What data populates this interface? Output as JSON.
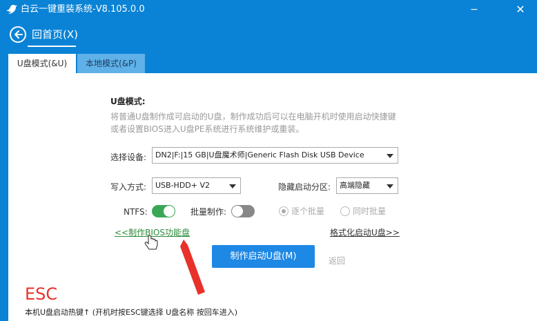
{
  "window": {
    "title": "白云一键重装系统-V8.105.0.0",
    "minimize_glyph": "−",
    "close_glyph": "✕"
  },
  "nav": {
    "back_label": "回首页(X)"
  },
  "tabs": [
    {
      "label": "U盘模式(&U)",
      "active": true
    },
    {
      "label": "本地模式(&P)",
      "active": false
    }
  ],
  "usb_mode": {
    "title": "U盘模式:",
    "description": "将普通U盘制作成可启动的U盘，制作成功后可以在电脑开机时使用启动快捷键或者设置BIOS进入U盘PE系统进行系统维护或重装。",
    "device_label": "选择设备:",
    "device_value": "DN2|F:|15 GB|U盘魔术师|Generic Flash Disk USB Device",
    "write_label": "写入方式:",
    "write_value": "USB-HDD+ V2",
    "hidden_partition_label": "隐藏启动分区:",
    "hidden_partition_value": "高端隐藏",
    "ntfs_label": "NTFS:",
    "ntfs_on": true,
    "batch_label": "批量制作:",
    "batch_on": false,
    "radio_one_by_one": "逐个批量",
    "radio_simultaneous": "同时批量",
    "bios_link": "<<制作BIOS功能盘",
    "format_link": "格式化启动U盘>>",
    "make_button": "制作启动U盘(M)",
    "back_text": "返回"
  },
  "footer": {
    "esc": "ESC",
    "hotkey_text": "本机U盘启动热键↑ (开机时按ESC键选择 U盘名称 按回车进入)"
  },
  "colors": {
    "brand_blue": "#0a83d6",
    "primary_button": "#1e88e5",
    "toggle_on": "#3aa757",
    "annotation_red": "#e8312a",
    "bios_link": "#2e8b3a"
  },
  "icons": {
    "logo": "bird-icon",
    "back": "back-arrow-icon",
    "cursor": "hand-cursor-icon",
    "annotation": "red-arrow-annotation"
  }
}
